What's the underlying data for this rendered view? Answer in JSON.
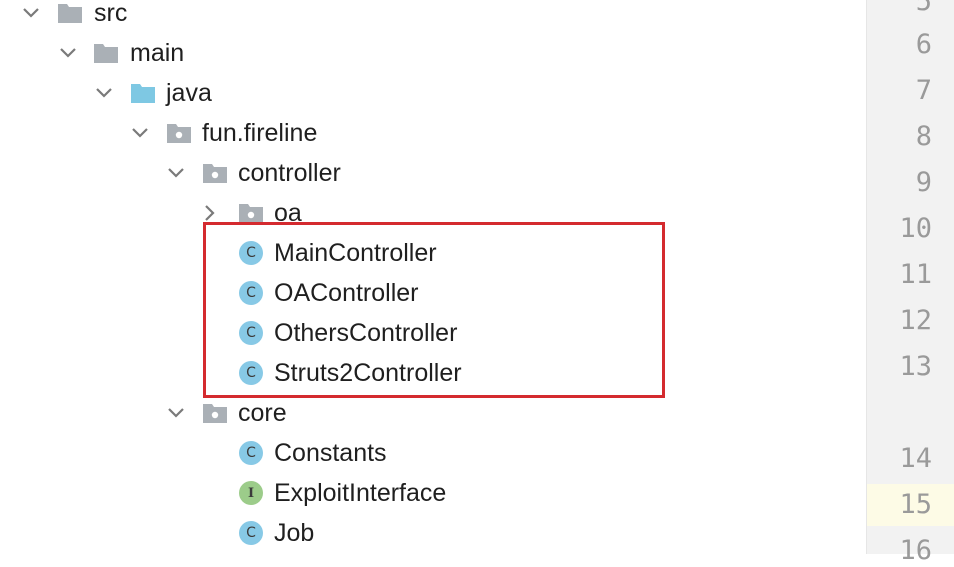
{
  "tree": {
    "src": {
      "label": "src",
      "icon": "folder-icon"
    },
    "main": {
      "label": "main",
      "icon": "folder-icon"
    },
    "java": {
      "label": "java",
      "icon": "source-root-folder-icon",
      "color": "#7ec8e3"
    },
    "fun_fireline": {
      "label": "fun.fireline",
      "icon": "package-icon"
    },
    "controller": {
      "label": "controller",
      "icon": "package-icon"
    },
    "oa": {
      "label": "oa",
      "icon": "package-icon"
    },
    "main_controller": {
      "label": "MainController",
      "badge": "C"
    },
    "oa_controller": {
      "label": "OAController",
      "badge": "C"
    },
    "others_controller": {
      "label": "OthersController",
      "badge": "C"
    },
    "struts2_controller": {
      "label": "Struts2Controller",
      "badge": "C"
    },
    "core": {
      "label": "core",
      "icon": "package-icon"
    },
    "constants": {
      "label": "Constants",
      "badge": "C"
    },
    "exploit_interface": {
      "label": "ExploitInterface",
      "badge": "I"
    },
    "job": {
      "label": "Job",
      "badge": "C"
    }
  },
  "highlight_color": "#d42a2f",
  "gutter": {
    "lines": [
      "5",
      "6",
      "7",
      "8",
      "9",
      "10",
      "11",
      "12",
      "13",
      "14",
      "15",
      "16"
    ],
    "current_line": "15"
  }
}
